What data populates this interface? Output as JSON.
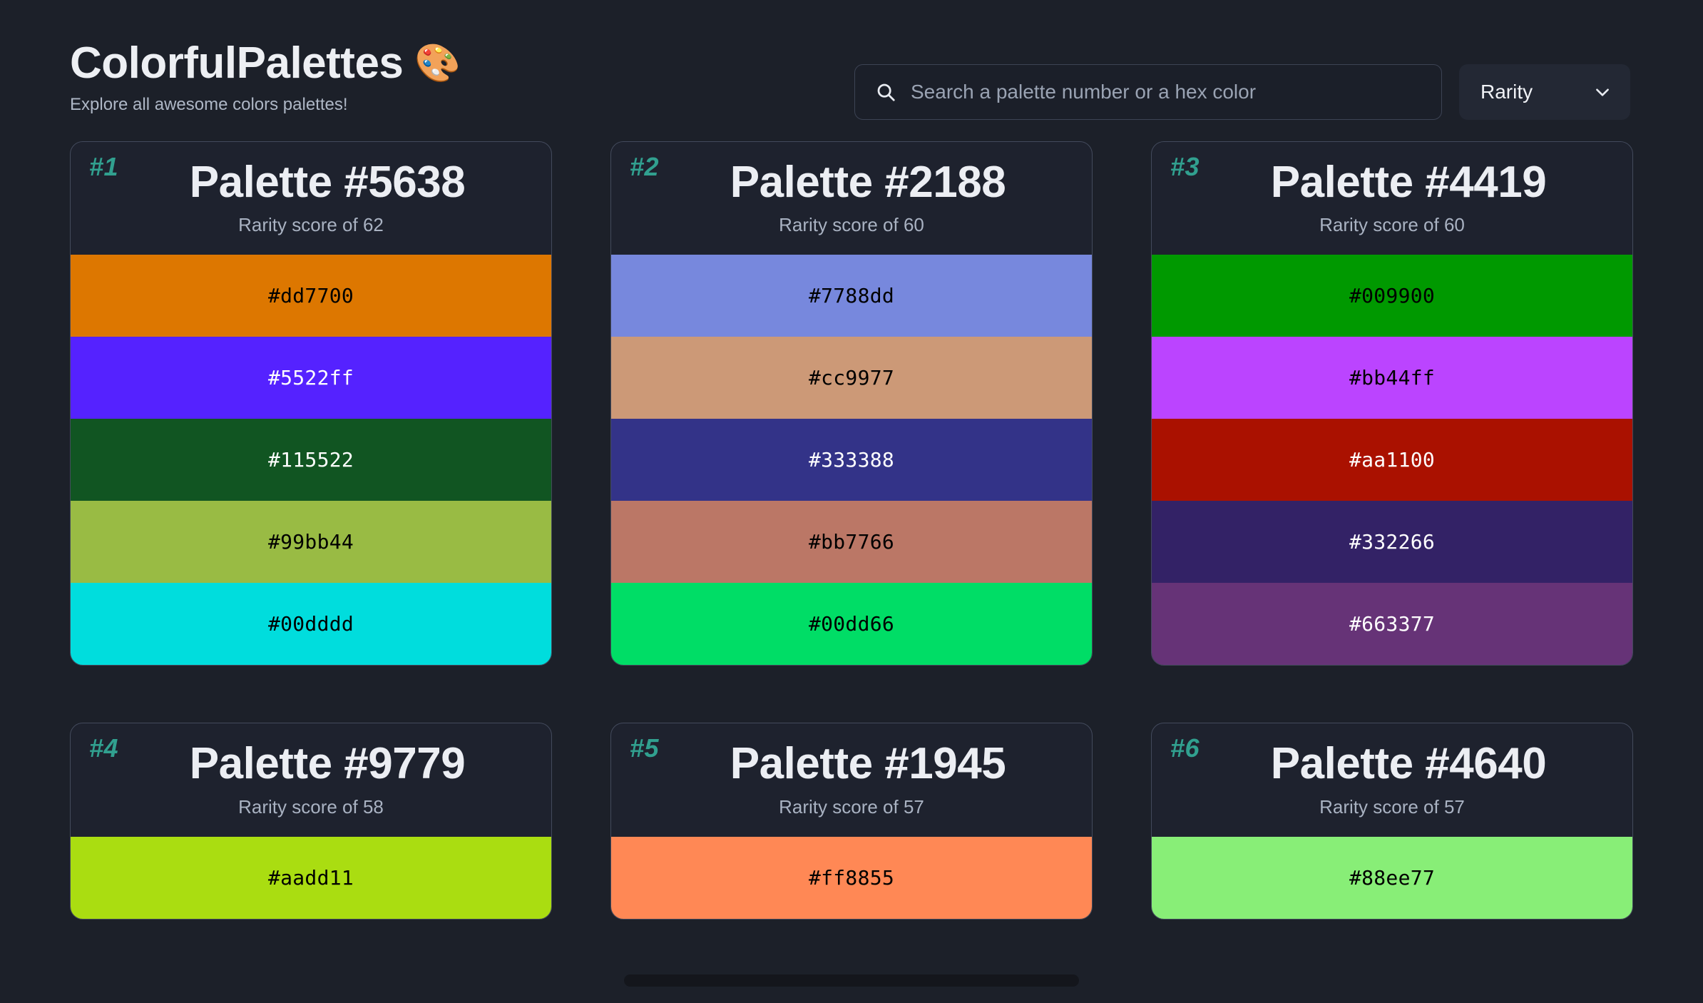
{
  "header": {
    "brand_title": "ColorfulPalettes",
    "brand_emoji": "🎨",
    "subtitle": "Explore all awesome colors palettes!",
    "search": {
      "placeholder": "Search a palette number or a hex color",
      "value": "",
      "icon": "search-icon"
    },
    "sort": {
      "label": "Rarity",
      "icon": "chevron-down-icon",
      "options": [
        "Rarity"
      ]
    }
  },
  "accent_color": "#31a08f",
  "background_color": "#1c2029",
  "card_background": "#1e222e",
  "card_border_color": "#434a5c",
  "palettes": [
    {
      "rank": "#1",
      "title": "Palette #5638",
      "rarity": "Rarity score of 62",
      "colors": [
        {
          "hex": "#dd7700",
          "text_color": "#000000"
        },
        {
          "hex": "#5522ff",
          "text_color": "#ffffff"
        },
        {
          "hex": "#115522",
          "text_color": "#ffffff"
        },
        {
          "hex": "#99bb44",
          "text_color": "#000000"
        },
        {
          "hex": "#00dddd",
          "text_color": "#000000"
        }
      ]
    },
    {
      "rank": "#2",
      "title": "Palette #2188",
      "rarity": "Rarity score of 60",
      "colors": [
        {
          "hex": "#7788dd",
          "text_color": "#000000"
        },
        {
          "hex": "#cc9977",
          "text_color": "#000000"
        },
        {
          "hex": "#333388",
          "text_color": "#ffffff"
        },
        {
          "hex": "#bb7766",
          "text_color": "#000000"
        },
        {
          "hex": "#00dd66",
          "text_color": "#000000"
        }
      ]
    },
    {
      "rank": "#3",
      "title": "Palette #4419",
      "rarity": "Rarity score of 60",
      "colors": [
        {
          "hex": "#009900",
          "text_color": "#000000"
        },
        {
          "hex": "#bb44ff",
          "text_color": "#000000"
        },
        {
          "hex": "#aa1100",
          "text_color": "#ffffff"
        },
        {
          "hex": "#332266",
          "text_color": "#ffffff"
        },
        {
          "hex": "#663377",
          "text_color": "#ffffff"
        }
      ]
    },
    {
      "rank": "#4",
      "title": "Palette #9779",
      "rarity": "Rarity score of 58",
      "colors": [
        {
          "hex": "#aadd11",
          "text_color": "#000000"
        }
      ]
    },
    {
      "rank": "#5",
      "title": "Palette #1945",
      "rarity": "Rarity score of 57",
      "colors": [
        {
          "hex": "#ff8855",
          "text_color": "#000000"
        }
      ]
    },
    {
      "rank": "#6",
      "title": "Palette #4640",
      "rarity": "Rarity score of 57",
      "colors": [
        {
          "hex": "#88ee77",
          "text_color": "#000000"
        }
      ]
    }
  ]
}
